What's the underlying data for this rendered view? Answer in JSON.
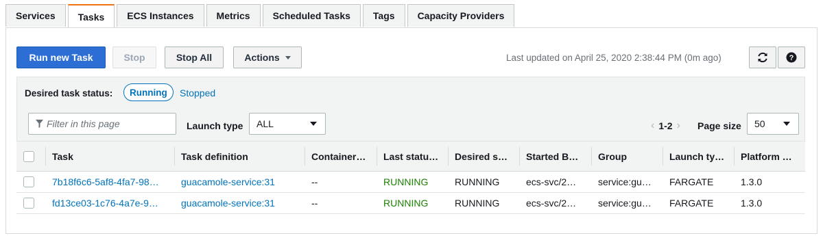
{
  "tabs": [
    "Services",
    "Tasks",
    "ECS Instances",
    "Metrics",
    "Scheduled Tasks",
    "Tags",
    "Capacity Providers"
  ],
  "active_tab": "Tasks",
  "toolbar": {
    "run_new_task": "Run new Task",
    "stop": "Stop",
    "stop_all": "Stop All",
    "actions": "Actions",
    "last_updated": "Last updated on April 25, 2020 2:38:44 PM (0m ago)",
    "refresh_icon": "refresh-icon",
    "help_icon": "help-icon"
  },
  "filters": {
    "desired_status_label": "Desired task status:",
    "status_running": "Running",
    "status_stopped": "Stopped",
    "filter_placeholder": "Filter in this page",
    "launch_type_label": "Launch type",
    "launch_type_value": "ALL",
    "pagination": "1-2",
    "page_size_label": "Page size",
    "page_size_value": "50"
  },
  "table": {
    "headers": [
      "Task",
      "Task definition",
      "Container…",
      "Last statu…",
      "Desired s…",
      "Started B…",
      "Group",
      "Launch ty…",
      "Platform …"
    ],
    "rows": [
      {
        "task": "7b18f6c6-5af8-4fa7-98…",
        "definition": "guacamole-service:31",
        "container": "--",
        "last_status": "RUNNING",
        "desired_status": "RUNNING",
        "started_by": "ecs-svc/2…",
        "group": "service:gu…",
        "launch_type": "FARGATE",
        "platform": "1.3.0"
      },
      {
        "task": "fd13ce03-1c76-4a7e-9…",
        "definition": "guacamole-service:31",
        "container": "--",
        "last_status": "RUNNING",
        "desired_status": "RUNNING",
        "started_by": "ecs-svc/2…",
        "group": "service:gu…",
        "launch_type": "FARGATE",
        "platform": "1.3.0"
      }
    ]
  },
  "colors": {
    "primary": "#2c6ed4",
    "link": "#0073bb",
    "running": "#1d8102",
    "active_tab_accent": "#ec7211"
  }
}
